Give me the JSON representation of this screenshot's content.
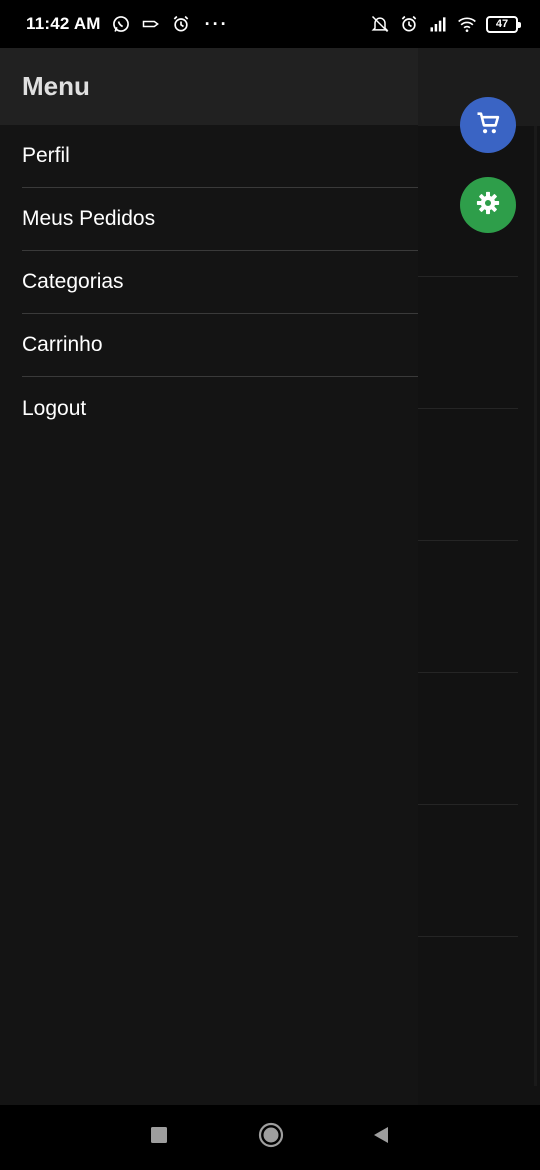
{
  "status_bar": {
    "time": "11:42 AM",
    "more": "···",
    "battery": "47",
    "left_icons": [
      "whatsapp-icon",
      "tag-icon",
      "alarm-icon"
    ],
    "right_icons": [
      "notifications-off-icon",
      "alarm-icon",
      "signal-icon",
      "wifi-icon",
      "battery-icon"
    ]
  },
  "drawer": {
    "title": "Menu",
    "items": [
      {
        "label": "Perfil"
      },
      {
        "label": "Meus Pedidos"
      },
      {
        "label": "Categorias"
      },
      {
        "label": "Carrinho"
      },
      {
        "label": "Logout"
      }
    ]
  },
  "background_app": {
    "fabs": [
      {
        "icon": "cart-icon",
        "color": "#3a64c4"
      },
      {
        "icon": "gear-icon",
        "color": "#2e9e4a"
      }
    ]
  },
  "nav_bar": {
    "buttons": [
      "recent-apps-icon",
      "home-icon",
      "back-icon"
    ]
  },
  "colors": {
    "drawer_bg": "#141414",
    "drawer_header_bg": "#212121",
    "divider": "#3a3a3a",
    "text": "#ffffff"
  }
}
